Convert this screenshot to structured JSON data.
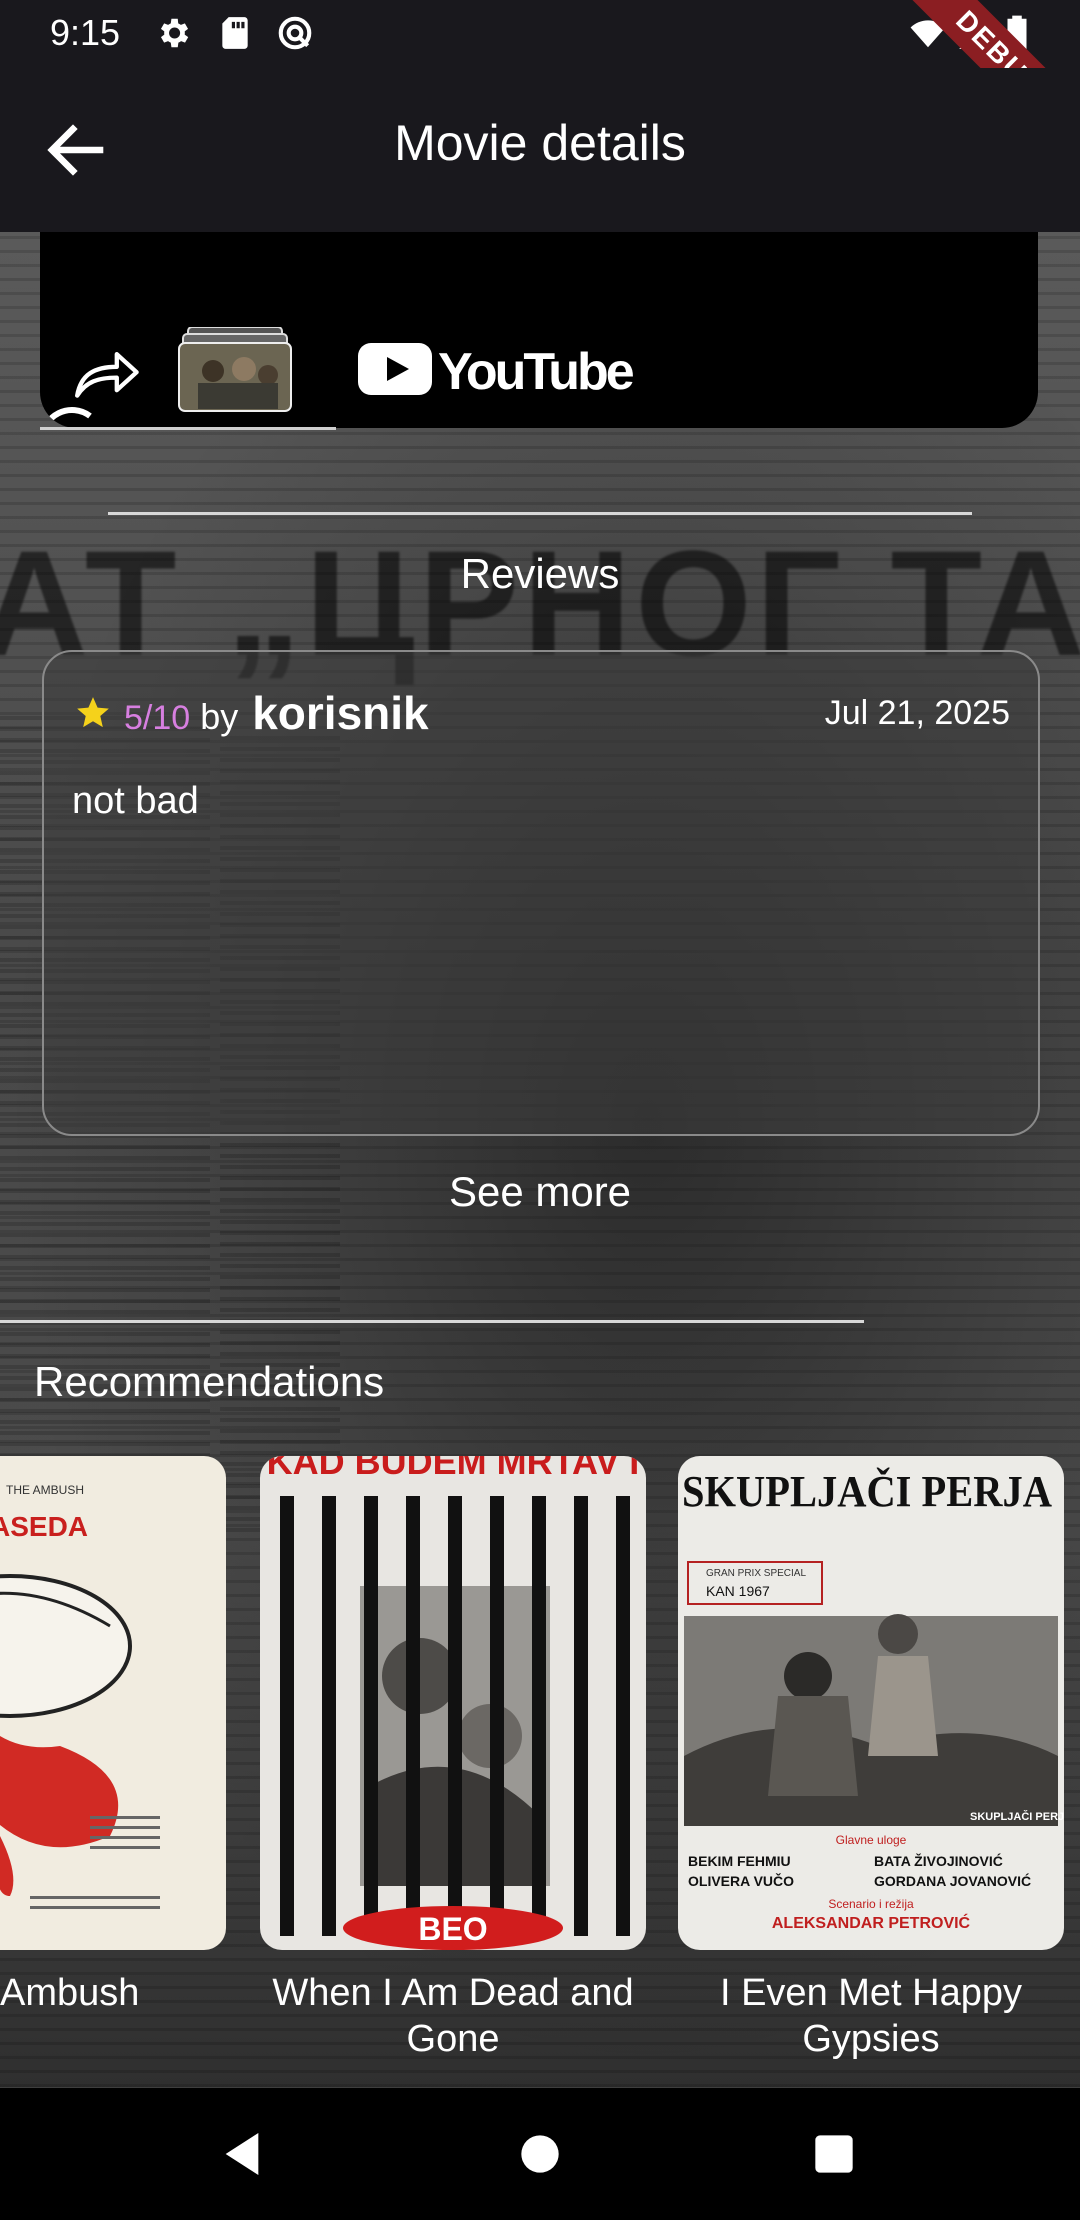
{
  "status_bar": {
    "time": "9:15",
    "icons": [
      "gear-icon",
      "sd-card-icon",
      "sync-icon",
      "wifi-icon",
      "signal-icon",
      "battery-icon"
    ],
    "debug_banner": "DEBUG"
  },
  "app_bar": {
    "title": "Movie details",
    "back_icon": "arrow-back-icon"
  },
  "trailer": {
    "brand": "YouTube",
    "icons": [
      "share-icon",
      "thumbnail-stack-icon",
      "youtube-logo-icon"
    ]
  },
  "reviews": {
    "title": "Reviews",
    "items": [
      {
        "rating": "5/10",
        "by": "by",
        "author": "korisnik",
        "date": "Jul 21, 2025",
        "text": "not bad"
      }
    ],
    "see_more": "See more"
  },
  "recommendations": {
    "title": "Recommendations",
    "items": [
      {
        "title": "Ambush"
      },
      {
        "title": "When I Am Dead and Gone"
      },
      {
        "title": "I Even Met Happy Gypsies"
      }
    ]
  },
  "posters": {
    "ambush_header": "THE AMBUSH",
    "ambush_word": "ASEDA",
    "dead_header": "KAD BUDEM MRTAV I",
    "dead_footer": "BEO",
    "gypsies_header": "SKUPLJAČI PERJA",
    "gypsies_award_1": "GRAN PRIX SPECIAL",
    "gypsies_award_2": "KAN 1967",
    "gypsies_cast_label": "Glavne uloge",
    "gypsies_cast": [
      "BEKIM FEHMIU",
      "BATA ŽIVOJINOVIĆ",
      "OLIVERA VUČO",
      "GORDANA JOVANOVIĆ"
    ],
    "gypsies_director_label": "Scenario i režija",
    "gypsies_director": "ALEKSANDAR PETROVIĆ",
    "gypsies_corner": "SKUPLJAČI PERJA"
  },
  "background_headline": "АТ „ЦРНОГ ТАЛ",
  "colors": {
    "app_bar": "#19181d",
    "rating": "#d77fe0",
    "star": "#f5d21b",
    "debug_ribbon": "#8b1e22"
  },
  "nav_bar": {
    "icons": [
      "back-triangle-icon",
      "home-circle-icon",
      "recents-square-icon"
    ]
  }
}
